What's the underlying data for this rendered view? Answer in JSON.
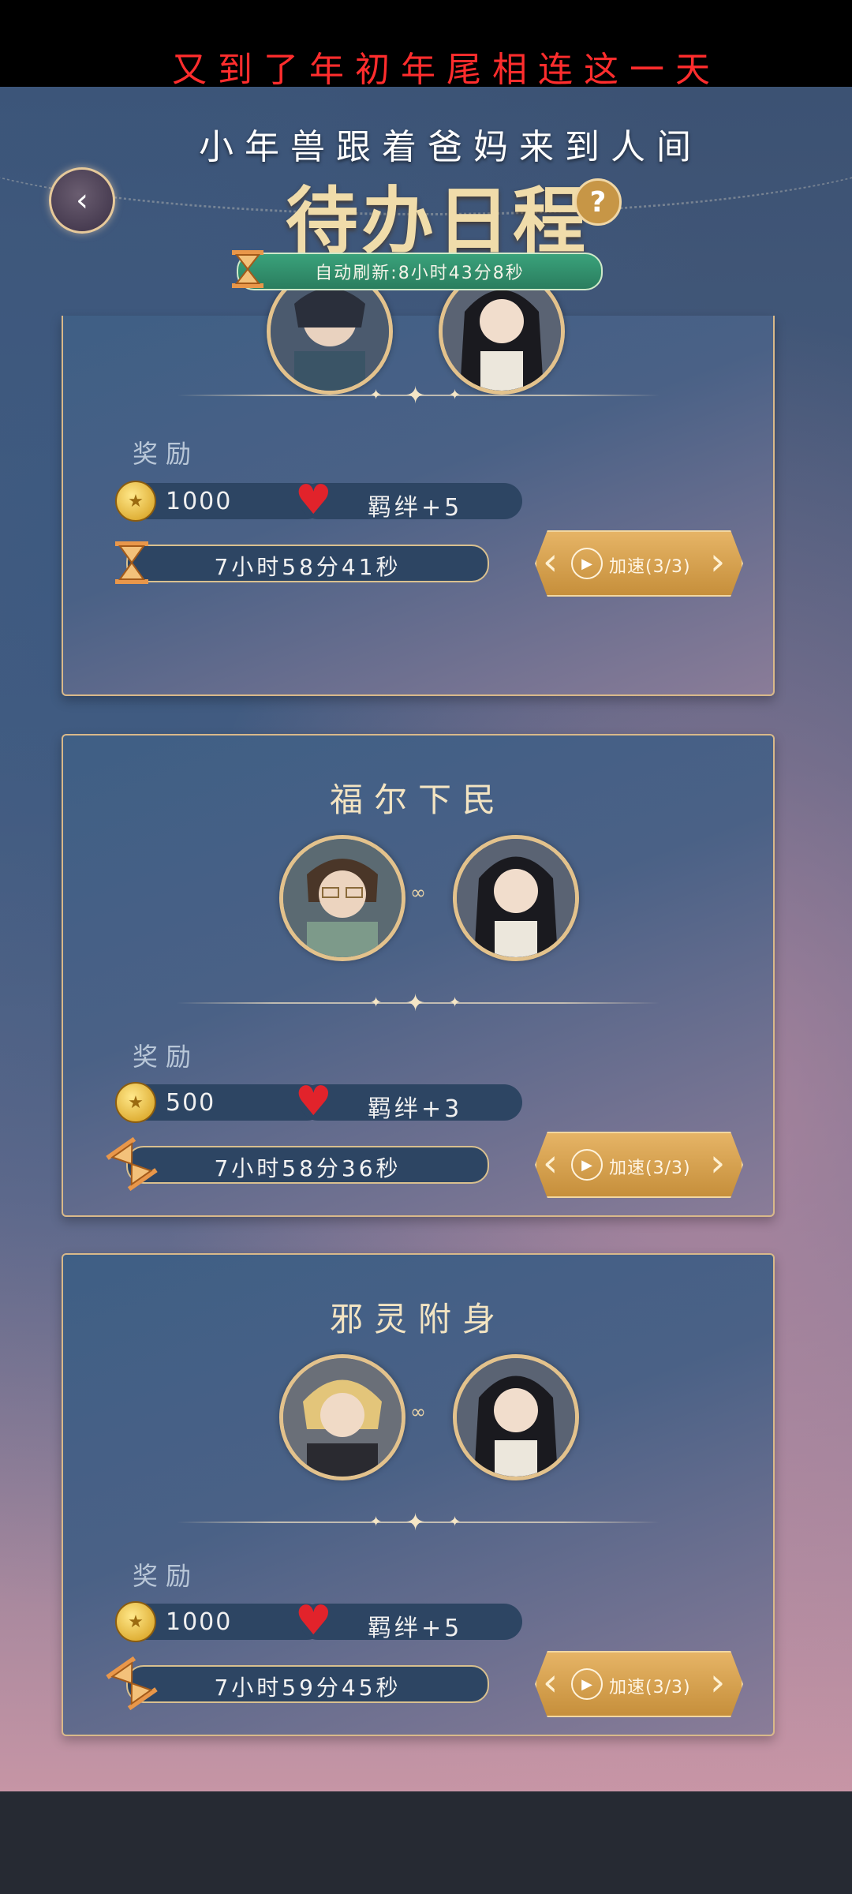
{
  "captions": {
    "line1": "又到了年初年尾相连这一天",
    "line2": "小年兽跟着爸妈来到人间"
  },
  "header": {
    "title": "待办日程",
    "help_icon": "?",
    "back_icon": "back-arrow-icon",
    "refresh": "自动刷新:8小时43分8秒"
  },
  "labels": {
    "reward": "奖励"
  },
  "schedules": [
    {
      "title": "",
      "coin": "1000",
      "bond": "羁绊+5",
      "timer": "7小时58分41秒",
      "speed": "加速(3/3)"
    },
    {
      "title": "福尔下民",
      "coin": "500",
      "bond": "羁绊+3",
      "timer": "7小时58分36秒",
      "speed": "加速(3/3)"
    },
    {
      "title": "邪灵附身",
      "coin": "1000",
      "bond": "羁绊+5",
      "timer": "7小时59分45秒",
      "speed": "加速(3/3)"
    }
  ],
  "colors": {
    "gold": "#e3c28c",
    "accent_green": "#3aa27b",
    "caption_red": "#ff2d2d"
  }
}
